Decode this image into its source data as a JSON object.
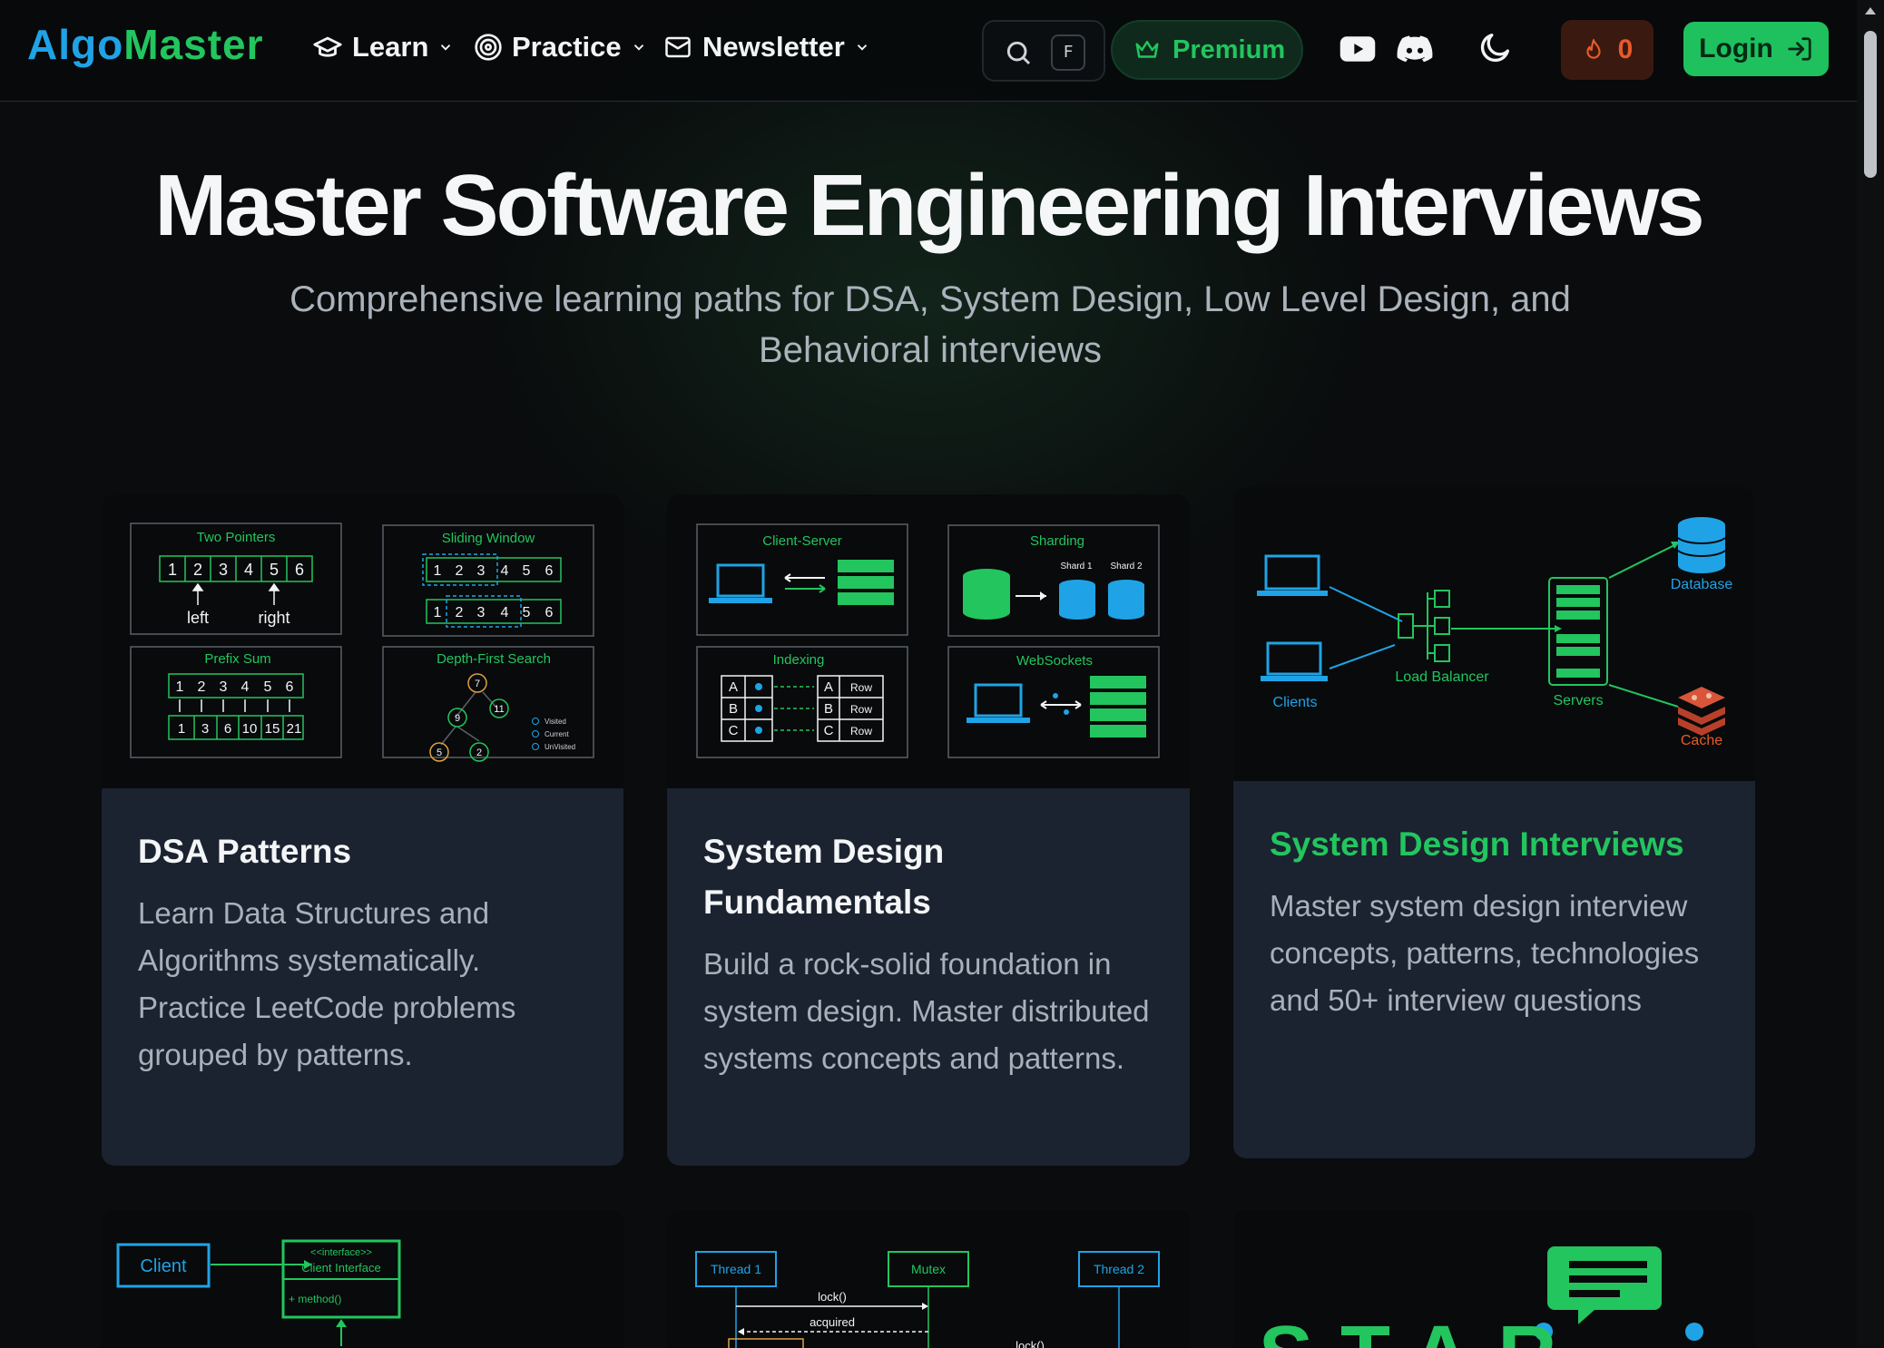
{
  "brand": {
    "part1": "Algo",
    "part2": "Master"
  },
  "nav": {
    "learn": "Learn",
    "practice": "Practice",
    "newsletter": "Newsletter"
  },
  "search": {
    "shortcut": "F"
  },
  "premium": "Premium",
  "streak": "0",
  "login": "Login",
  "hero": {
    "title": "Master Software Engineering Interviews",
    "subtitle": "Comprehensive learning paths for DSA, System Design, Low Level Design, and Behavioral interviews"
  },
  "cards": [
    {
      "title": "DSA Patterns",
      "description": "Learn Data Structures and Algorithms systematically. Practice LeetCode problems grouped by patterns.",
      "art": {
        "two_pointers": "Two Pointers",
        "sliding_window": "Sliding Window",
        "prefix_sum": "Prefix Sum",
        "dfs": "Depth-First Search",
        "left": "left",
        "right": "right",
        "visited": "Visited",
        "current": "Current",
        "unvisited": "UnVisited"
      }
    },
    {
      "title": "System Design Fundamentals",
      "description": "Build a rock-solid foundation in system design. Master distributed systems concepts and patterns.",
      "art": {
        "client_server": "Client-Server",
        "sharding": "Sharding",
        "shard1": "Shard 1",
        "shard2": "Shard 2",
        "indexing": "Indexing",
        "websockets": "WebSockets",
        "row": "Row"
      }
    },
    {
      "title": "System Design Interviews",
      "description": "Master system design interview concepts, patterns, technologies and 50+ interview questions",
      "art": {
        "database": "Database",
        "clients": "Clients",
        "load_balancer": "Load Balancer",
        "servers": "Servers",
        "cache": "Cache"
      }
    }
  ],
  "bottom_cards": {
    "lld": {
      "client": "Client",
      "interface_tag": "<<interface>>",
      "interface_name": "Client Interface",
      "method": "+ method()"
    },
    "concurrency": {
      "thread1": "Thread 1",
      "mutex": "Mutex",
      "thread2": "Thread 2",
      "lock": "lock()",
      "acquired": "acquired",
      "lock2": "lock()"
    },
    "behavioral": {
      "star": "STAR"
    }
  },
  "colors": {
    "green": "#22c55e",
    "blue": "#1fa3e6",
    "card_bg": "#1b2230"
  }
}
